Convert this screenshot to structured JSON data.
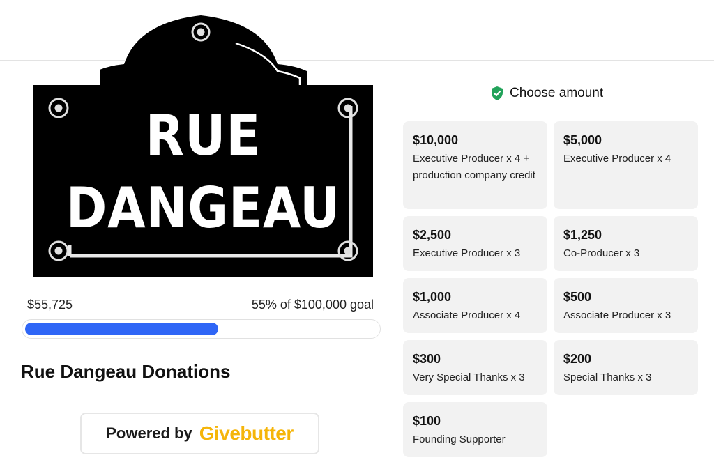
{
  "sign": {
    "line1": "RUE",
    "line2": "DANGEAU"
  },
  "progress": {
    "raised": "$55,725",
    "goal_text": "55% of $100,000 goal",
    "percent": 55
  },
  "campaign": {
    "title": "Rue Dangeau Donations"
  },
  "powered_by": {
    "label": "Powered by",
    "brand": "Givebutter",
    "brand_color": "#f5b50a"
  },
  "amounts": {
    "heading": "Choose amount",
    "heading_icon": "shield-check-icon",
    "accent": "#22a35a",
    "options": [
      {
        "amount": "$10,000",
        "desc": "Executive Producer x 4 + production company credit"
      },
      {
        "amount": "$5,000",
        "desc": "Executive Producer x 4"
      },
      {
        "amount": "$2,500",
        "desc": "Executive Producer x 3"
      },
      {
        "amount": "$1,250",
        "desc": "Co-Producer x 3"
      },
      {
        "amount": "$1,000",
        "desc": "Associate Producer x 4"
      },
      {
        "amount": "$500",
        "desc": "Associate Producer x 3"
      },
      {
        "amount": "$300",
        "desc": "Very Special Thanks x 3"
      },
      {
        "amount": "$200",
        "desc": "Special Thanks x 3"
      },
      {
        "amount": "$100",
        "desc": "Founding Supporter"
      }
    ]
  }
}
